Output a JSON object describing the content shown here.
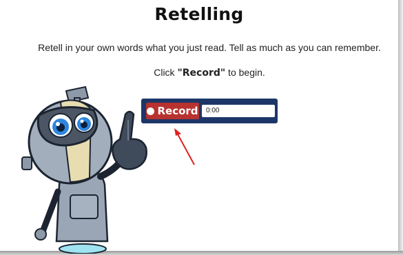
{
  "title": "Retelling",
  "instruction": "Retell in your own words what you just read. Tell as much as you can remember.",
  "prompt": {
    "prefix": "Click ",
    "keyword": "\"Record\"",
    "suffix": " to begin."
  },
  "recorder": {
    "record_label": "Record",
    "timer": "0:00"
  },
  "colors": {
    "recorder_bg": "#1d3668",
    "record_button": "#b8322f",
    "arrow": "#e02020"
  },
  "icons": [
    "record-dot-icon",
    "robot-mascot",
    "pointer-arrow-icon"
  ]
}
